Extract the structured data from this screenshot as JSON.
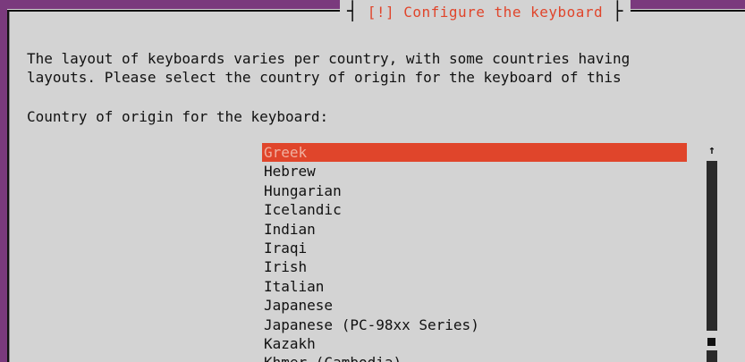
{
  "dialog": {
    "title_left_bracket": "┤",
    "title": "[!] Configure the keyboard",
    "title_right_bracket": "├",
    "description_line1": "The layout of keyboards varies per country, with some countries having",
    "description_line2": "layouts. Please select the country of origin for the keyboard of this",
    "prompt": "Country of origin for the keyboard:",
    "options": [
      {
        "label": "Greek"
      },
      {
        "label": "Hebrew"
      },
      {
        "label": "Hungarian"
      },
      {
        "label": "Icelandic"
      },
      {
        "label": "Indian"
      },
      {
        "label": "Iraqi"
      },
      {
        "label": "Irish"
      },
      {
        "label": "Italian"
      },
      {
        "label": "Japanese"
      },
      {
        "label": "Japanese (PC-98xx Series)"
      },
      {
        "label": "Kazakh"
      },
      {
        "label": "Khmer (Cambodia)"
      }
    ],
    "selected_option": "Greek",
    "scroll_up_arrow": "↑"
  },
  "colors": {
    "desktop_background": "#7a3a7d",
    "dialog_background": "#d3d3d3",
    "accent": "#e0452b",
    "text": "#111111"
  }
}
